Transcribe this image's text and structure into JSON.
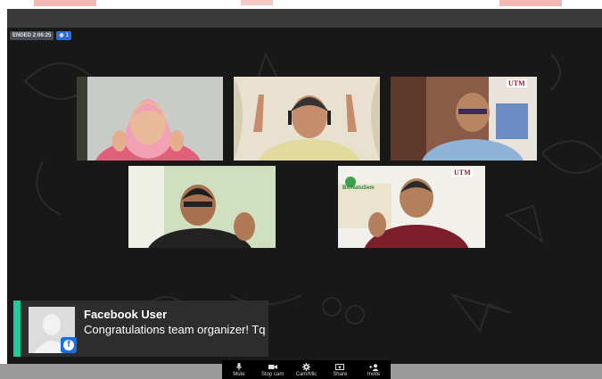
{
  "status": {
    "ended_label": "ENDED 2:06:25",
    "viewer_count": "1"
  },
  "comment": {
    "user_name": "Facebook User",
    "message": "Congratulations team organizer! Tq",
    "accent_color": "#1fcb9b"
  },
  "tiles": {
    "tile_3_logo": "UTM",
    "tile_5_logo": "UTM",
    "tile_5_banner": "BioNatuSem"
  },
  "toolbar": {
    "mute_label": "Mute",
    "stop_cam_label": "Stop cam",
    "cam_mic_label": "Cam/Mic",
    "share_label": "Share",
    "invite_label": "Invite"
  }
}
